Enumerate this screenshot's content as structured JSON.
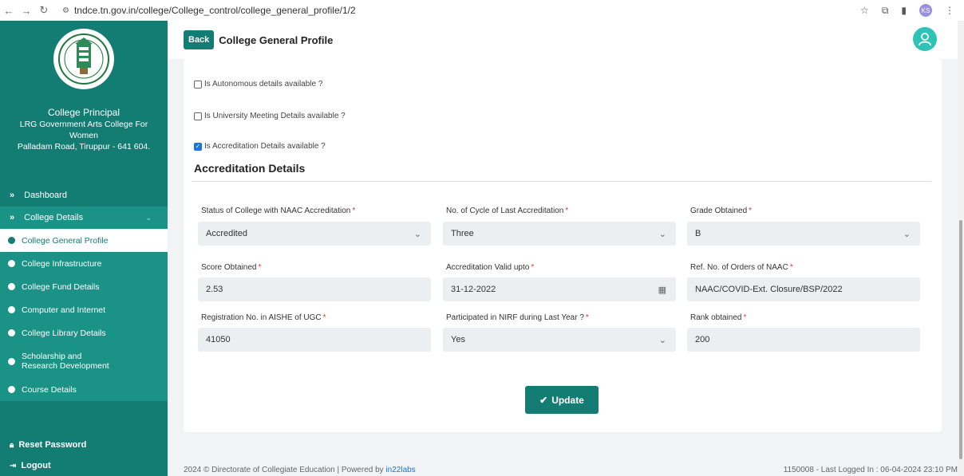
{
  "browser": {
    "url": "tndce.tn.gov.in/college/College_control/college_general_profile/1/2",
    "profile_initials": "KS"
  },
  "sidebar": {
    "role": "College Principal",
    "college_name_line1": "LRG Government Arts College For",
    "college_name_line2": "Women",
    "college_name_line3": "Palladam Road, Tiruppur - 641 604.",
    "dashboard_label": "Dashboard",
    "college_details_label": "College Details",
    "sub_items": [
      "College General Profile",
      "College Infrastructure",
      "College Fund Details",
      "Computer and Internet",
      "College Library Details",
      "Scholarship and Research Development",
      "Course Details"
    ],
    "reset_password_label": "Reset Password",
    "logout_label": "Logout"
  },
  "header": {
    "back_label": "Back",
    "title": "College General Profile"
  },
  "form": {
    "check_autonomous": "Is Autonomous details available ?",
    "check_university_meeting": "Is University Meeting Details available ?",
    "check_accreditation": "Is Accreditation Details available ?",
    "section_title": "Accreditation Details",
    "fields": {
      "naac_status_label": "Status of College with NAAC Accreditation",
      "naac_status_value": "Accredited",
      "cycle_label": "No. of Cycle of Last Accreditation",
      "cycle_value": "Three",
      "grade_label": "Grade Obtained",
      "grade_value": "B",
      "score_label": "Score Obtained",
      "score_value": "2.53",
      "valid_label": "Accreditation Valid upto",
      "valid_value": "31-12-2022",
      "ref_label": "Ref. No. of Orders of NAAC",
      "ref_value": "NAAC/COVID-Ext. Closure/BSP/2022",
      "aishe_label": "Registration No. in AISHE of UGC",
      "aishe_value": "41050",
      "nirf_label": "Participated in NIRF during Last Year ?",
      "nirf_value": "Yes",
      "rank_label": "Rank obtained",
      "rank_value": "200"
    },
    "update_label": "Update"
  },
  "footer": {
    "left_text": "2024 © Directorate of Collegiate Education | Powered by",
    "left_link": "in22labs",
    "right_text": "1150008 - Last Logged In : 06-04-2024 23:10 PM"
  }
}
